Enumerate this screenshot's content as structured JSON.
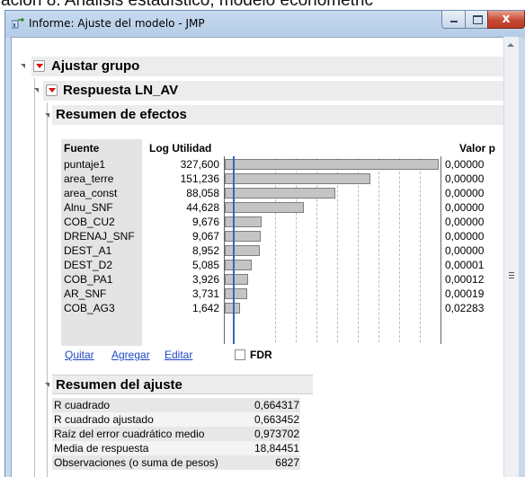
{
  "caption_cropped": "ación 8: Análisis estadístico, modelo econométric",
  "window": {
    "title": "Informe: Ajuste del modelo - JMP",
    "close_label": "x"
  },
  "report": {
    "group_title": "Ajustar grupo",
    "response_title": "Respuesta LN_AV",
    "effects": {
      "title": "Resumen de efectos",
      "col_source": "Fuente",
      "col_logworth": "Log Utilidad",
      "col_pvalue": "Valor p",
      "rows": [
        {
          "source": "puntaje1",
          "logworth": "327,600",
          "pvalue": "0,00000",
          "logworth_num": 327.6
        },
        {
          "source": "area_terre",
          "logworth": "151,236",
          "pvalue": "0,00000",
          "logworth_num": 151.236
        },
        {
          "source": "area_const",
          "logworth": "88,058",
          "pvalue": "0,00000",
          "logworth_num": 88.058
        },
        {
          "source": "Alnu_SNF",
          "logworth": "44,628",
          "pvalue": "0,00000",
          "logworth_num": 44.628
        },
        {
          "source": "COB_CU2",
          "logworth": "9,676",
          "pvalue": "0,00000",
          "logworth_num": 9.676
        },
        {
          "source": "DRENAJ_SNF",
          "logworth": "9,067",
          "pvalue": "0,00000",
          "logworth_num": 9.067
        },
        {
          "source": "DEST_A1",
          "logworth": "8,952",
          "pvalue": "0,00000",
          "logworth_num": 8.952
        },
        {
          "source": "DEST_D2",
          "logworth": "5,085",
          "pvalue": "0,00001",
          "logworth_num": 5.085
        },
        {
          "source": "COB_PA1",
          "logworth": "3,926",
          "pvalue": "0,00012",
          "logworth_num": 3.926
        },
        {
          "source": "AR_SNF",
          "logworth": "3,731",
          "pvalue": "0,00019",
          "logworth_num": 3.731
        },
        {
          "source": "COB_AG3",
          "logworth": "1,642",
          "pvalue": "0,02283",
          "logworth_num": 1.642
        }
      ],
      "links": {
        "remove": "Quitar",
        "add": "Agregar",
        "edit": "Editar"
      },
      "fdr_label": "FDR",
      "fdr_checked": false
    },
    "fit": {
      "title": "Resumen del ajuste",
      "rows": [
        {
          "label": "R cuadrado",
          "value": "0,664317"
        },
        {
          "label": "R cuadrado ajustado",
          "value": "0,663452"
        },
        {
          "label": "Raíz del error cuadrático medio",
          "value": "0,973702"
        },
        {
          "label": "Media de respuesta",
          "value": "18,84451"
        },
        {
          "label": "Observaciones (o suma de pesos)",
          "value": "6827"
        }
      ]
    }
  },
  "colors": {
    "accent_link": "#1f47c4",
    "ref_line": "#3a62c8",
    "menu_triangle": "#d01010",
    "bar_fill": "#c4c4c4"
  }
}
